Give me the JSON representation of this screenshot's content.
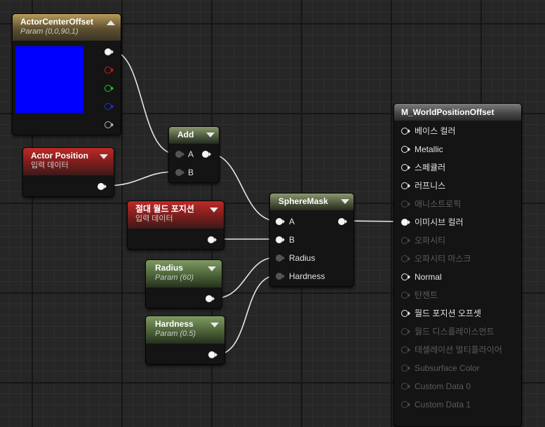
{
  "nodes": {
    "actor_center_offset": {
      "title": "ActorCenterOffset",
      "subtitle": "Param (0,0,90,1)",
      "swatch_color": "#0000ff"
    },
    "actor_position": {
      "title": "Actor Position",
      "subtitle": "입력 데이터"
    },
    "add": {
      "title": "Add",
      "pin_a": "A",
      "pin_b": "B"
    },
    "absolute_world_position": {
      "title": "절대 월드 포지션",
      "subtitle": "입력 데이터"
    },
    "radius": {
      "title": "Radius",
      "subtitle": "Param (60)"
    },
    "hardness": {
      "title": "Hardness",
      "subtitle": "Param (0.5)"
    },
    "sphere_mask": {
      "title": "SphereMask",
      "pin_a": "A",
      "pin_b": "B",
      "pin_radius": "Radius",
      "pin_hardness": "Hardness"
    },
    "material": {
      "title": "M_WorldPositionOffset",
      "pins": [
        {
          "label": "베이스 컬러",
          "state": "active"
        },
        {
          "label": "Metallic",
          "state": "active"
        },
        {
          "label": "스페큘러",
          "state": "active"
        },
        {
          "label": "러프니스",
          "state": "active"
        },
        {
          "label": "애니소트로픽",
          "state": "disabled"
        },
        {
          "label": "이미시브 컬러",
          "state": "connected"
        },
        {
          "label": "오파시티",
          "state": "disabled"
        },
        {
          "label": "오파시티 마스크",
          "state": "disabled"
        },
        {
          "label": "Normal",
          "state": "active"
        },
        {
          "label": "탄젠트",
          "state": "disabled"
        },
        {
          "label": "월드 포지션 오프셋",
          "state": "active"
        },
        {
          "label": "월드 디스플레이스먼트",
          "state": "disabled"
        },
        {
          "label": "테셀레이션 멀티플라이어",
          "state": "disabled"
        },
        {
          "label": "Subsurface Color",
          "state": "disabled"
        },
        {
          "label": "Custom Data 0",
          "state": "disabled"
        },
        {
          "label": "Custom Data 1",
          "state": "disabled"
        }
      ]
    }
  },
  "colors": {
    "wire": "#e6e6e6",
    "pin_red": "#e01515",
    "pin_green": "#18d018",
    "pin_blue": "#2030e8"
  }
}
